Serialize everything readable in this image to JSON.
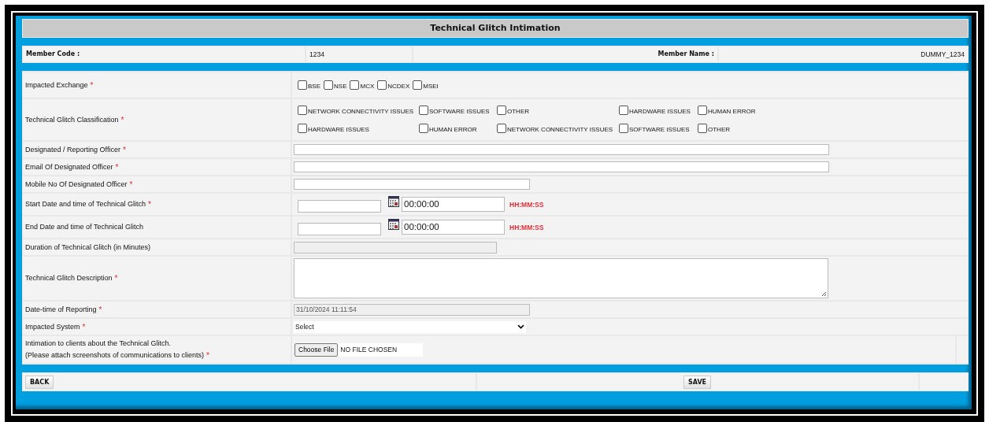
{
  "title": "Technical Glitch Intimation",
  "member": {
    "code_label": "Member Code :",
    "code": "1234",
    "name_label": "Member Name :",
    "name": "DUMMY_1234"
  },
  "rows": [
    {
      "kind": "checkboxes",
      "label": "Impacted Exchange",
      "mark": "*",
      "options": [
        {
          "label": "BSE",
          "checked": false
        },
        {
          "label": "NSE",
          "checked": false
        },
        {
          "label": "MCX",
          "checked": false
        },
        {
          "label": "NCDEX",
          "checked": false
        },
        {
          "label": "MSEI",
          "checked": false
        }
      ]
    },
    {
      "kind": "checkbox_grid",
      "label": "Technical Glitch Classification",
      "mark": "*",
      "options": [
        {
          "label": "NETWORK CONNECTIVITY ISSUES",
          "checked": false
        },
        {
          "label": "SOFTWARE ISSUES",
          "checked": false
        },
        {
          "label": "OTHER",
          "checked": false
        },
        {
          "label": "HARDWARE ISSUES",
          "checked": false
        },
        {
          "label": "HUMAN ERROR",
          "checked": false
        },
        {
          "label": "HARDWARE ISSUES",
          "checked": false
        },
        {
          "label": "HUMAN ERROR",
          "checked": false
        },
        {
          "label": "NETWORK CONNECTIVITY ISSUES",
          "checked": false
        },
        {
          "label": "SOFTWARE ISSUES",
          "checked": false
        },
        {
          "label": "OTHER",
          "checked": false
        }
      ]
    },
    {
      "kind": "widetext",
      "label": "Designated / Reporting Officer",
      "mark": "*"
    },
    {
      "kind": "widetext",
      "label": "Email Of Designated Officer",
      "mark": "*"
    },
    {
      "kind": "text",
      "label": "Mobile No Of Designated Officer",
      "mark": "*"
    },
    {
      "kind": "datetime",
      "label": "Start Date and time of Technical Glitch",
      "mark": "*",
      "time": "00:00:00",
      "format": "HH:MM:SS"
    },
    {
      "kind": "datetime",
      "label": "End Date and time of Technical Glitch",
      "time": "00:00:00",
      "format": "HH:MM:SS"
    },
    {
      "kind": "readonly",
      "label": "Duration of Technical Glitch (in Minutes)"
    },
    {
      "kind": "textarea",
      "label": "Technical Glitch Description",
      "mark": "*"
    },
    {
      "kind": "readonly",
      "label": "Date-time of Reporting",
      "mark": "*",
      "value": "31/10/2024 11:11:54"
    },
    {
      "kind": "select",
      "label": "Impacted System",
      "mark": "*",
      "value": "Select"
    },
    {
      "kind": "file",
      "label": "Intimation to clients about the Technical Glitch.",
      "note": "(Please attach screenshots of communications to clients)",
      "mark": "*",
      "button": "Choose File",
      "value": "NO FILE CHOSEN"
    }
  ],
  "buttons": {
    "back": "BACK",
    "save": "SAVE"
  }
}
